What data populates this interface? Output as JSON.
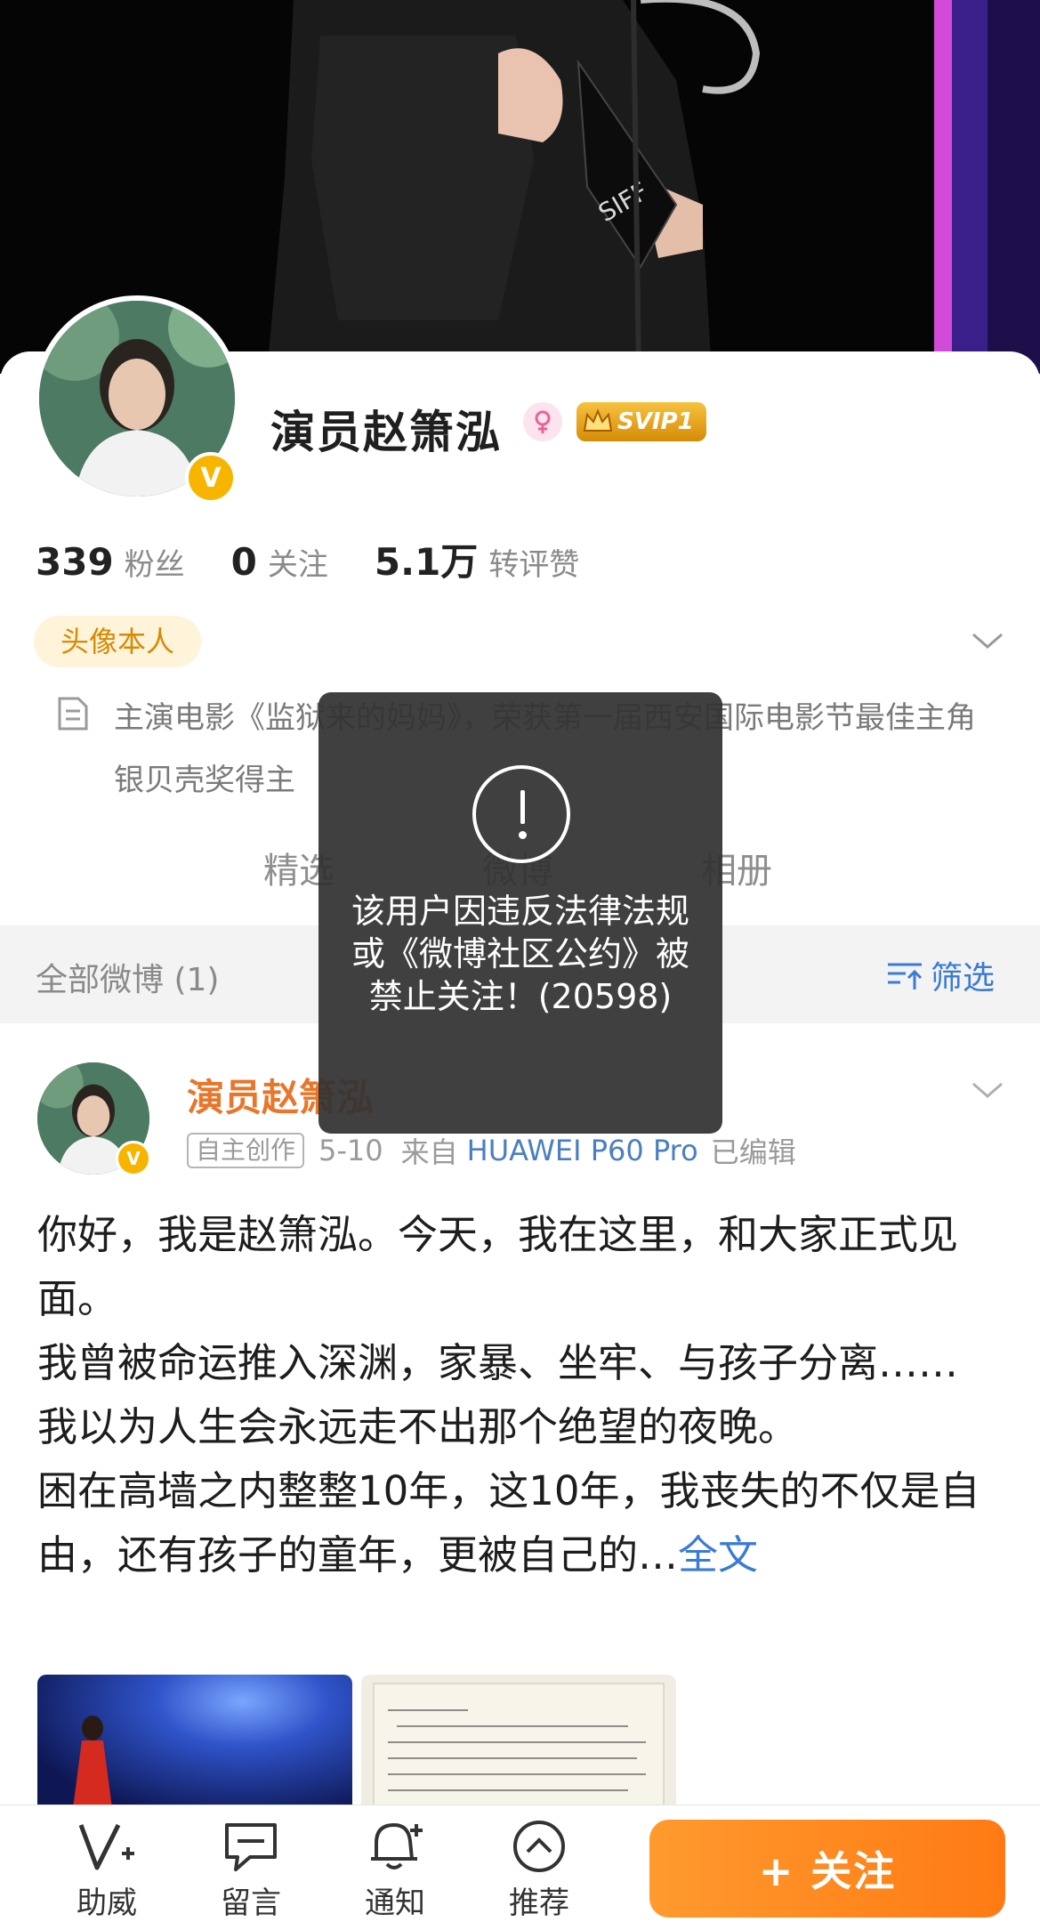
{
  "profile": {
    "nickname": "演员赵箫泓",
    "verified_badge": "V",
    "vip_label": "SVIP1",
    "stats": [
      {
        "value": "339",
        "label": "粉丝"
      },
      {
        "value": "0",
        "label": "关注"
      },
      {
        "value": "5.1万",
        "label": "转评赞"
      }
    ],
    "tag": "头像本人",
    "bio": "主演电影《监狱来的妈妈》，荣获第一届西安国际电影节最佳主角银贝壳奖得主",
    "tabs": [
      "精选",
      "微博",
      "相册"
    ]
  },
  "filter": {
    "count_label": "全部微博 (1)",
    "button_label": "筛选"
  },
  "post": {
    "author": "演员赵箫泓",
    "badge": "自主创作",
    "date": "5-10",
    "source_prefix": "来自",
    "device": "HUAWEI P60 Pro",
    "edited": "已编辑",
    "paragraphs": [
      "你好，我是赵箫泓。今天，我在这里，和大家正式见面。",
      "我曾被命运推入深渊，家暴、坐牢、与孩子分离…… 我以为人生会永远走不出那个绝望的夜晚。",
      "困在高墙之内整整10年，这10年，我丧失的不仅是自由，还有孩子的童年，更被自己的…"
    ],
    "full_text_link": "全文"
  },
  "toast": {
    "message": "该用户因违反法律法规或《微博社区公约》被禁止关注！(20598)"
  },
  "bottom_bar": {
    "items": [
      "助威",
      "留言",
      "通知",
      "推荐"
    ],
    "follow_label": "+ 关注"
  },
  "colors": {
    "accent_orange": "#ff8a1f",
    "link_blue": "#3a7bd5",
    "vip_gold": "#f7b500",
    "tag_text": "#d68a06"
  }
}
